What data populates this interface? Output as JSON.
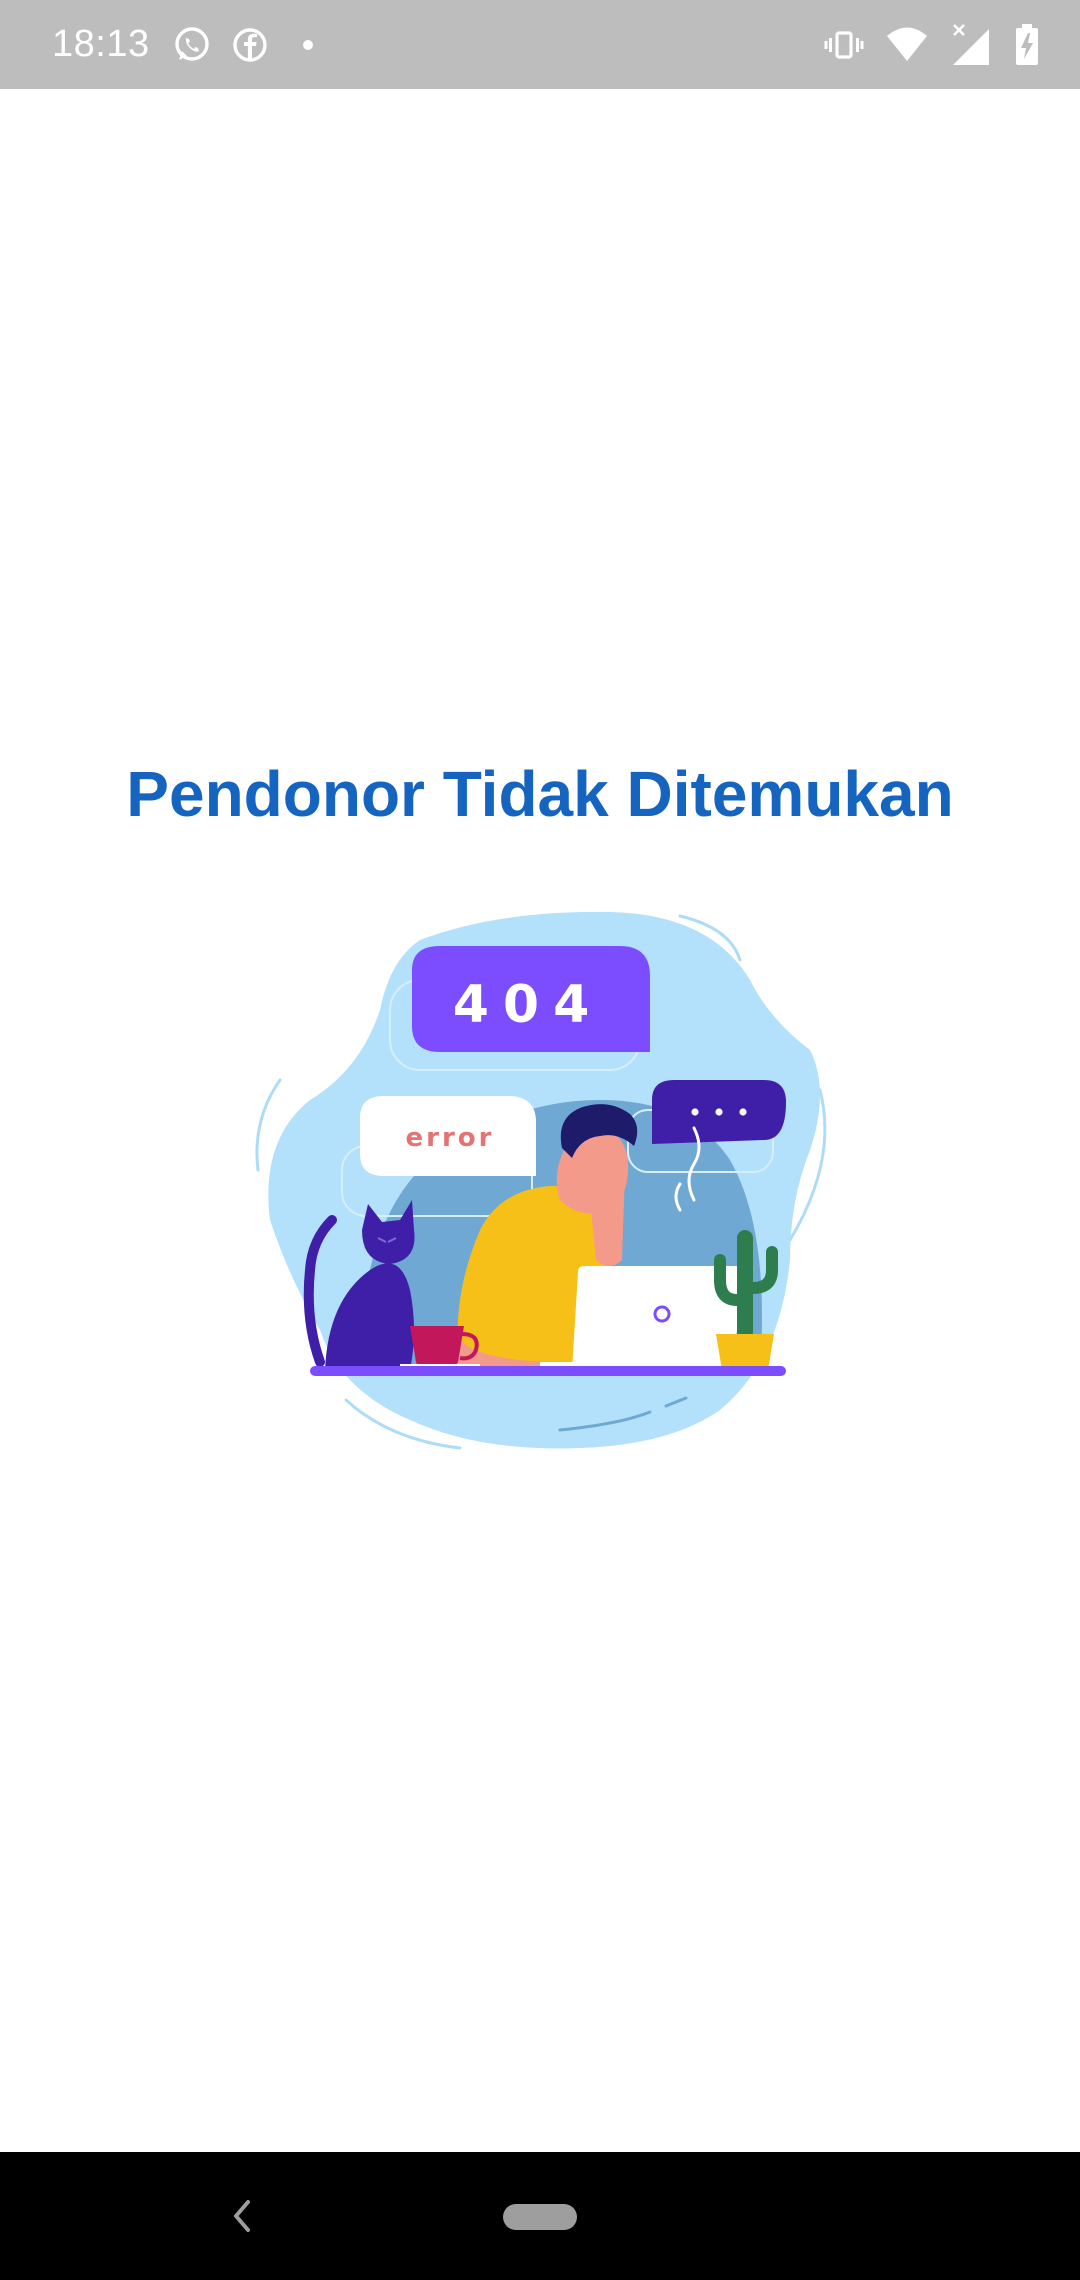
{
  "status_bar": {
    "time": "18:13",
    "left_icons": [
      "whatsapp-icon",
      "facebook-icon",
      "dot-icon"
    ],
    "right_icons": [
      "vibrate-icon",
      "wifi-icon",
      "signal-icon",
      "battery-charging-icon"
    ],
    "background": "#bdbdbd"
  },
  "main": {
    "title": "Pendonor Tidak Ditemukan",
    "title_color": "#1565c0",
    "illustration": {
      "code_text": "404",
      "error_text": "error",
      "dots_text": "..."
    }
  },
  "nav_bar": {
    "icons": [
      "back-icon",
      "home-pill-icon"
    ]
  }
}
